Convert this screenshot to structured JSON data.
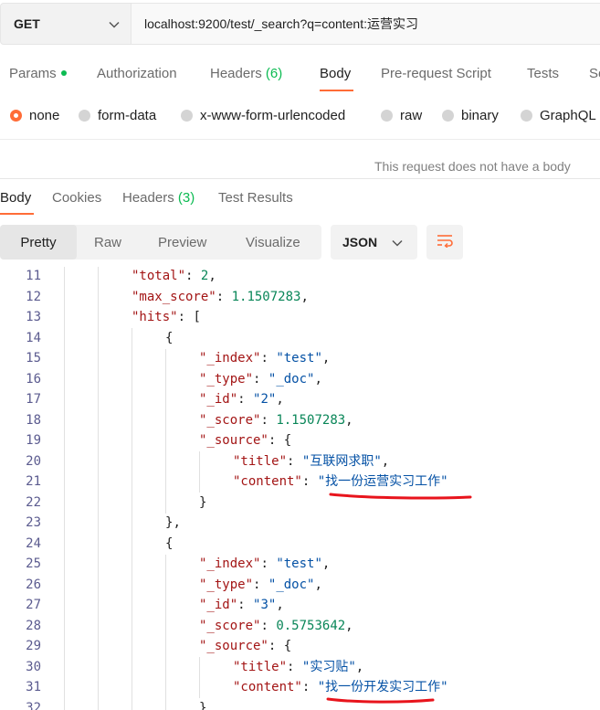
{
  "request": {
    "method": "GET",
    "url": "localhost:9200/test/_search?q=content:运营实习"
  },
  "request_tabs": [
    {
      "label": "Params",
      "count": ""
    },
    {
      "label": "Authorization",
      "count": ""
    },
    {
      "label": "Headers",
      "count": "(6)"
    },
    {
      "label": "Body",
      "count": ""
    },
    {
      "label": "Pre-request Script",
      "count": ""
    },
    {
      "label": "Tests",
      "count": ""
    },
    {
      "label": "Se",
      "count": ""
    }
  ],
  "body_types": [
    "none",
    "form-data",
    "x-www-form-urlencoded",
    "raw",
    "binary",
    "GraphQL"
  ],
  "no_body_text": "This request does not have a body",
  "response_tabs": [
    {
      "label": "Body",
      "count": ""
    },
    {
      "label": "Cookies",
      "count": ""
    },
    {
      "label": "Headers",
      "count": "(3)"
    },
    {
      "label": "Test Results",
      "count": ""
    }
  ],
  "view_modes": [
    "Pretty",
    "Raw",
    "Preview",
    "Visualize"
  ],
  "format": "JSON",
  "colors": {
    "accent": "#ff6c37",
    "green": "#0cbb52",
    "key": "#a31515",
    "string": "#0451a5",
    "number": "#098658"
  },
  "icons": [
    "chevron-down-icon",
    "wrap-lines-icon"
  ],
  "code_lines": [
    {
      "n": "11",
      "t": "\"total\": 2,"
    },
    {
      "n": "12",
      "t": "\"max_score\": 1.1507283,"
    },
    {
      "n": "13",
      "t": "\"hits\": ["
    },
    {
      "n": "14",
      "t": "{"
    },
    {
      "n": "15",
      "t": "\"_index\": \"test\","
    },
    {
      "n": "16",
      "t": "\"_type\": \"_doc\","
    },
    {
      "n": "17",
      "t": "\"_id\": \"2\","
    },
    {
      "n": "18",
      "t": "\"_score\": 1.1507283,"
    },
    {
      "n": "19",
      "t": "\"_source\": {"
    },
    {
      "n": "20",
      "t": "\"title\": \"互联网求职\","
    },
    {
      "n": "21",
      "t": "\"content\": \"找一份运营实习工作\""
    },
    {
      "n": "22",
      "t": "}"
    },
    {
      "n": "23",
      "t": "},"
    },
    {
      "n": "24",
      "t": "{"
    },
    {
      "n": "25",
      "t": "\"_index\": \"test\","
    },
    {
      "n": "26",
      "t": "\"_type\": \"_doc\","
    },
    {
      "n": "27",
      "t": "\"_id\": \"3\","
    },
    {
      "n": "28",
      "t": "\"_score\": 0.5753642,"
    },
    {
      "n": "29",
      "t": "\"_source\": {"
    },
    {
      "n": "30",
      "t": "\"title\": \"实习贴\","
    },
    {
      "n": "31",
      "t": "\"content\": \"找一份开发实习工作\""
    },
    {
      "n": "32",
      "t": "}"
    }
  ]
}
